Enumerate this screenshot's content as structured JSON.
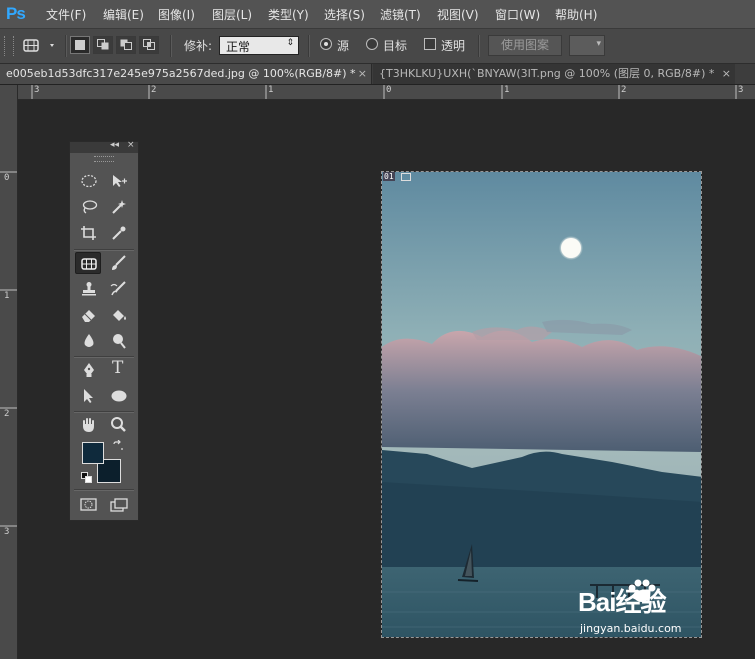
{
  "app": {
    "logo": "Ps"
  },
  "menubar": {
    "items": [
      "文件(F)",
      "编辑(E)",
      "图像(I)",
      "图层(L)",
      "类型(Y)",
      "选择(S)",
      "滤镜(T)",
      "视图(V)",
      "窗口(W)",
      "帮助(H)"
    ]
  },
  "options": {
    "patch_label": "修补:",
    "patch_mode": "正常",
    "source_label": "源",
    "source_selected": true,
    "target_label": "目标",
    "target_selected": false,
    "transparent_label": "透明",
    "transparent_checked": false,
    "use_pattern_label": "使用图案",
    "icons": {
      "tool_preset": "patch-tool-icon",
      "dropdown": "chevron-down-icon"
    }
  },
  "tabs": [
    {
      "label": "e005eb1d53dfc317e245e975a2567ded.jpg @ 100%(RGB/8#) *",
      "active": true,
      "close": "×"
    },
    {
      "label": "{T3HKLKU}UXH(`BNYAW(3IT.png @ 100% (图层 0, RGB/8#) *",
      "active": false,
      "close": "×"
    }
  ],
  "rulers": {
    "top_labels": [
      "3",
      "2",
      "1",
      "0",
      "1",
      "2",
      "3"
    ],
    "left_labels": [
      "0",
      "1",
      "2",
      "3"
    ]
  },
  "tools_panel": {
    "header_collapse": "◂◂",
    "header_close": "×",
    "tools": [
      "elliptical-marquee-tool-icon",
      "move-tool-icon",
      "lasso-tool-icon",
      "magic-wand-tool-icon",
      "crop-tool-icon",
      "eyedropper-tool-icon",
      "patch-tool-icon",
      "brush-tool-icon",
      "clone-stamp-tool-icon",
      "history-brush-tool-icon",
      "eraser-tool-icon",
      "paint-bucket-tool-icon",
      "blur-tool-icon",
      "dodge-tool-icon",
      "pen-tool-icon",
      "type-tool-icon",
      "path-selection-tool-icon",
      "ellipse-shape-tool-icon",
      "hand-tool-icon",
      "zoom-tool-icon"
    ],
    "active_tool": "patch-tool-icon",
    "type_tool_glyph": "T",
    "foreground_color": "#0f2a3c",
    "background_color": "#0c1f2c"
  },
  "canvas": {
    "layer_badge": "01"
  },
  "watermark": {
    "main": "Bai经验",
    "url": "jingyan.baidu.com"
  }
}
